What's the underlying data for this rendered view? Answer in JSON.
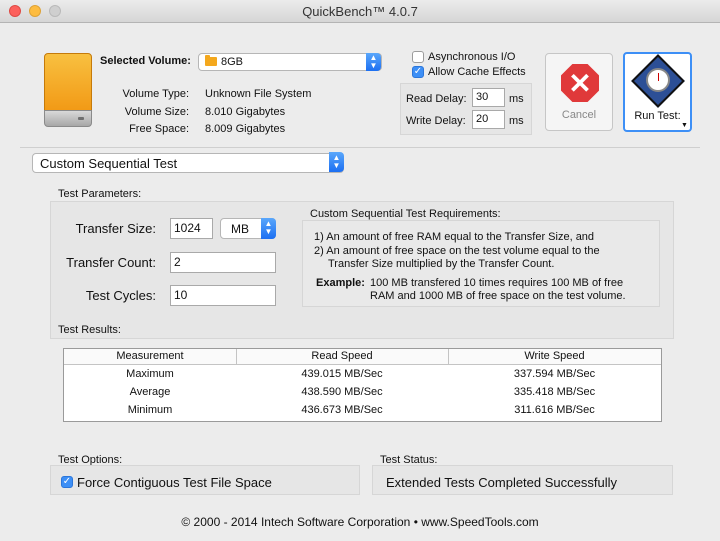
{
  "window": {
    "title": "QuickBench™ 4.0.7"
  },
  "volume": {
    "label": "Selected Volume:",
    "selected": "8GB",
    "type_label": "Volume Type:",
    "type_value": "Unknown File System",
    "size_label": "Volume Size:",
    "size_value": "8.010 Gigabytes",
    "free_label": "Free Space:",
    "free_value": "8.009 Gigabytes"
  },
  "options": {
    "async_label": "Asynchronous I/O",
    "async_checked": false,
    "cache_label": "Allow Cache Effects",
    "cache_checked": true,
    "read_delay_label": "Read Delay:",
    "read_delay_value": "30",
    "write_delay_label": "Write Delay:",
    "write_delay_value": "20",
    "unit": "ms"
  },
  "buttons": {
    "cancel": "Cancel",
    "run": "Run Test:"
  },
  "test_mode": {
    "selected": "Custom Sequential Test"
  },
  "params": {
    "title": "Test Parameters:",
    "transfer_size_label": "Transfer Size:",
    "transfer_size_value": "1024",
    "transfer_size_unit": "MB",
    "transfer_count_label": "Transfer Count:",
    "transfer_count_value": "2",
    "cycles_label": "Test Cycles:",
    "cycles_value": "10"
  },
  "requirements": {
    "title": "Custom Sequential Test Requirements:",
    "line1": "1) An amount of free RAM equal to the Transfer Size, and",
    "line2": "2) An amount of free space on the test volume equal to the",
    "line3": "Transfer Size multiplied by the Transfer Count.",
    "example_label": "Example:",
    "example_line1": "100 MB transfered 10 times requires 100 MB of free",
    "example_line2": "RAM and 1000 MB of free space on the test volume."
  },
  "results": {
    "title": "Test Results:",
    "headers": [
      "Measurement",
      "Read Speed",
      "Write Speed"
    ],
    "rows": [
      [
        "Maximum",
        "439.015 MB/Sec",
        "337.594 MB/Sec"
      ],
      [
        "Average",
        "438.590 MB/Sec",
        "335.418 MB/Sec"
      ],
      [
        "Minimum",
        "436.673 MB/Sec",
        "311.616 MB/Sec"
      ]
    ]
  },
  "test_options": {
    "title": "Test Options:",
    "contiguous_label": "Force Contiguous Test File Space",
    "contiguous_checked": true
  },
  "test_status": {
    "title": "Test Status:",
    "value": "Extended Tests Completed Successfully"
  },
  "footer": "© 2000 - 2014 Intech Software Corporation • www.SpeedTools.com"
}
